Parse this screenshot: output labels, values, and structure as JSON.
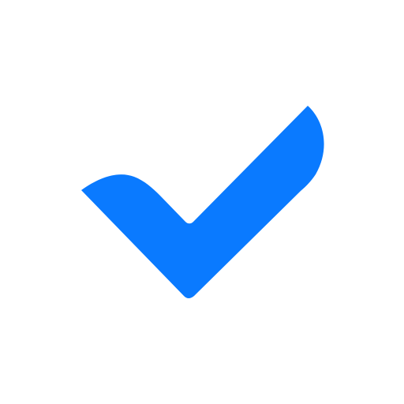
{
  "icon": {
    "name": "checkmark-icon",
    "color": "#0A7AFF",
    "background": "#FFFFFF"
  }
}
